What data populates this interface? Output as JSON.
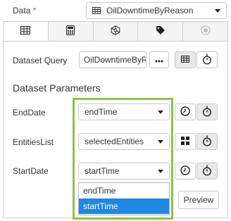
{
  "data_field": {
    "label": "Data",
    "required_mark": "*",
    "value": "OilDowntimeByReason"
  },
  "tabs": [
    {
      "icon": "table-icon",
      "active": true
    },
    {
      "icon": "calculator-icon",
      "active": false
    },
    {
      "icon": "network-icon",
      "active": false
    },
    {
      "icon": "tag-icon",
      "active": false
    },
    {
      "icon": "radio-icon",
      "active": false
    }
  ],
  "dataset_query": {
    "label": "Dataset Query",
    "value": "OilDowntimeByR"
  },
  "section_title": "Dataset Parameters",
  "params": [
    {
      "label": "EndDate",
      "value": "endTime"
    },
    {
      "label": "EntitiesList",
      "value": "selectedEntities"
    },
    {
      "label": "StartDate",
      "value": "startTime"
    }
  ],
  "dropdown_options": [
    "endTime",
    "startTime"
  ],
  "preview_label": "Preview",
  "colors": {
    "highlight": "#8bc34a",
    "selected_option": "#1e88e5",
    "required": "#e03a3a"
  }
}
